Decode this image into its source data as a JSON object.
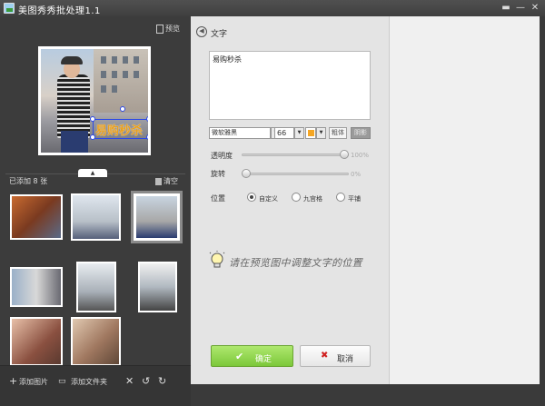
{
  "window": {
    "title": "美图秀秀批处理1.1",
    "menu_icon": "menu-icon",
    "minimize": "—",
    "close": "✕"
  },
  "left": {
    "preview_label": "预览",
    "overlay_text": "易购秒杀",
    "added_count": "已添加 8 张",
    "clear_label": "清空",
    "add_image": "添加图片",
    "add_folder": "添加文件夹",
    "thumbs": 8
  },
  "right": {
    "title": "文字",
    "text_value": "易购秒杀",
    "font_name": "微软雅黑",
    "font_size": "66",
    "color": "#f5a623",
    "bold_label": "粗体",
    "shadow_label": "阴影",
    "opacity_label": "透明度",
    "opacity_value": "100%",
    "opacity": 1.0,
    "rotation_label": "旋转",
    "rotation_value": "0%",
    "rotation": 0.0,
    "position_label": "位置",
    "position_options": [
      "自定义",
      "九宫格",
      "平铺"
    ],
    "position_selected": "自定义",
    "hint": "请在预览图中调整文字的位置",
    "ok_label": "确定",
    "cancel_label": "取消"
  }
}
